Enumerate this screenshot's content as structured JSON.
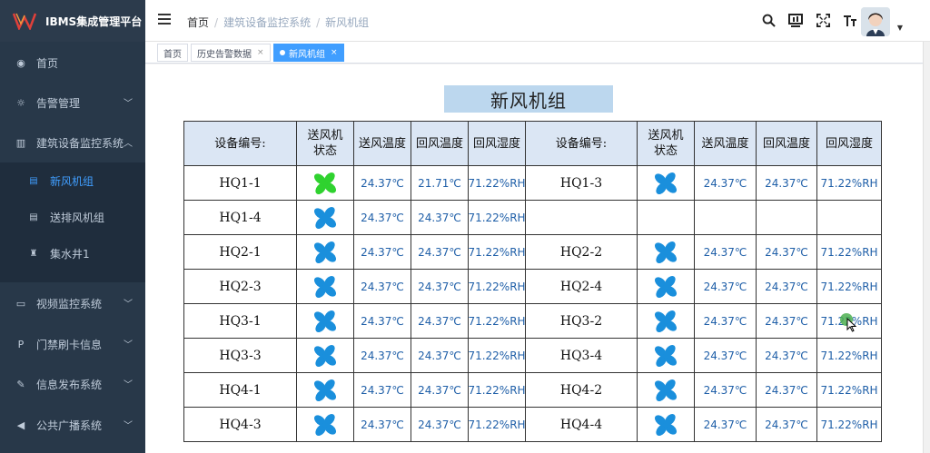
{
  "app": {
    "title": "IBMS集成管理平台"
  },
  "sidebar": {
    "items": [
      {
        "label": "首页",
        "icon": "dashboard-icon"
      },
      {
        "label": "告警管理",
        "icon": "alarm-icon"
      },
      {
        "label": "建筑设备监控系统",
        "icon": "building-icon"
      },
      {
        "label": "视频监控系统",
        "icon": "monitor-icon"
      },
      {
        "label": "门禁刷卡信息",
        "icon": "access-card-icon"
      },
      {
        "label": "信息发布系统",
        "icon": "edit-icon"
      },
      {
        "label": "公共广播系统",
        "icon": "megaphone-icon"
      }
    ],
    "subitems": [
      {
        "label": "新风机组",
        "icon": "unit-icon"
      },
      {
        "label": "送排风机组",
        "icon": "unit-icon"
      },
      {
        "label": "集水井1",
        "icon": "pump-icon"
      }
    ]
  },
  "header": {
    "breadcrumb": [
      "首页",
      "建筑设备监控系统",
      "新风机组"
    ],
    "icons": [
      "search-icon",
      "screen-icon",
      "fullscreen-icon",
      "font-size-icon"
    ]
  },
  "tags": [
    {
      "label": "首页"
    },
    {
      "label": "历史告警数据",
      "close": "×"
    },
    {
      "label": "新风机组",
      "close": "×"
    }
  ],
  "page": {
    "title": "新风机组"
  },
  "table": {
    "headers": [
      "设备编号:",
      "送风机\n状态",
      "送风温度",
      "回风温度",
      "回风湿度",
      "设备编号:",
      "送风机\n状态",
      "送风温度",
      "回风温度",
      "回风湿度"
    ],
    "rows": [
      {
        "left": {
          "id": "HQ1-1",
          "fan": "green",
          "supply": "24.37℃",
          "return": "21.71℃",
          "humidity": "71.22%RH"
        },
        "right": {
          "id": "HQ1-3",
          "fan": "blue",
          "supply": "24.37℃",
          "return": "24.37℃",
          "humidity": "71.22%RH"
        }
      },
      {
        "left": {
          "id": "HQ1-4",
          "fan": "blue",
          "supply": "24.37℃",
          "return": "24.37℃",
          "humidity": "71.22%RH"
        },
        "right": {
          "id": "",
          "fan": "",
          "supply": "",
          "return": "",
          "humidity": ""
        }
      },
      {
        "left": {
          "id": "HQ2-1",
          "fan": "blue",
          "supply": "24.37℃",
          "return": "24.37℃",
          "humidity": "71.22%RH"
        },
        "right": {
          "id": "HQ2-2",
          "fan": "blue",
          "supply": "24.37℃",
          "return": "24.37℃",
          "humidity": "71.22%RH"
        }
      },
      {
        "left": {
          "id": "HQ2-3",
          "fan": "blue",
          "supply": "24.37℃",
          "return": "24.37℃",
          "humidity": "71.22%RH"
        },
        "right": {
          "id": "HQ2-4",
          "fan": "blue",
          "supply": "24.37℃",
          "return": "24.37℃",
          "humidity": "71.22%RH"
        }
      },
      {
        "left": {
          "id": "HQ3-1",
          "fan": "blue",
          "supply": "24.37℃",
          "return": "24.37℃",
          "humidity": "71.22%RH"
        },
        "right": {
          "id": "HQ3-2",
          "fan": "blue",
          "supply": "24.37℃",
          "return": "24.37℃",
          "humidity": "71.22%RH"
        }
      },
      {
        "left": {
          "id": "HQ3-3",
          "fan": "blue",
          "supply": "24.37℃",
          "return": "24.37℃",
          "humidity": "71.22%RH"
        },
        "right": {
          "id": "HQ3-4",
          "fan": "blue",
          "supply": "24.37℃",
          "return": "24.37℃",
          "humidity": "71.22%RH"
        }
      },
      {
        "left": {
          "id": "HQ4-1",
          "fan": "blue",
          "supply": "24.37℃",
          "return": "24.37℃",
          "humidity": "71.22%RH"
        },
        "right": {
          "id": "HQ4-2",
          "fan": "blue",
          "supply": "24.37℃",
          "return": "24.37℃",
          "humidity": "71.22%RH"
        }
      },
      {
        "left": {
          "id": "HQ4-3",
          "fan": "blue",
          "supply": "24.37℃",
          "return": "24.37℃",
          "humidity": "71.22%RH"
        },
        "right": {
          "id": "HQ4-4",
          "fan": "blue",
          "supply": "24.37℃",
          "return": "24.37℃",
          "humidity": "71.22%RH"
        }
      }
    ]
  },
  "colors": {
    "fan_blue": "#1a8fdc",
    "fan_green": "#2fd22f",
    "value_text": "#1f5fa8",
    "header_bg": "#dbe6f4",
    "sidebar_bg": "#283849",
    "accent": "#409eff"
  }
}
